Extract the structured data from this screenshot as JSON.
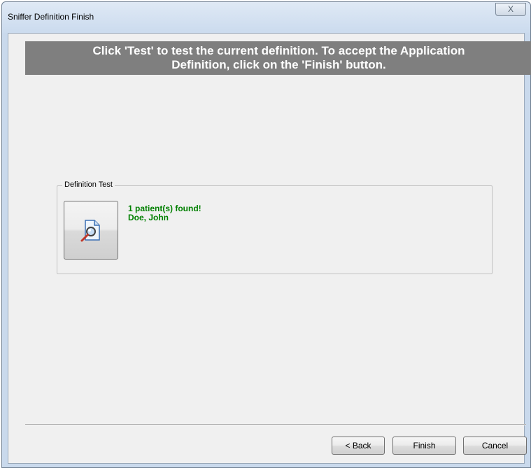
{
  "window": {
    "title": "Sniffer Definition Finish",
    "close_glyph": "X"
  },
  "banner": {
    "line1": "Click 'Test' to test the current definition.  To accept the Application",
    "line2": "Definition, click on the 'Finish' button."
  },
  "definition_test": {
    "group_label": "Definition Test",
    "test_button_icon": "document-magnifier-icon",
    "result_lines": [
      "1 patient(s) found!",
      "Doe, John"
    ]
  },
  "buttons": {
    "back": "< Back",
    "finish": "Finish",
    "cancel": "Cancel"
  },
  "colors": {
    "banner_bg": "#7f7f7f",
    "result_text": "#008000",
    "dialog_bg": "#f0f0f0"
  }
}
